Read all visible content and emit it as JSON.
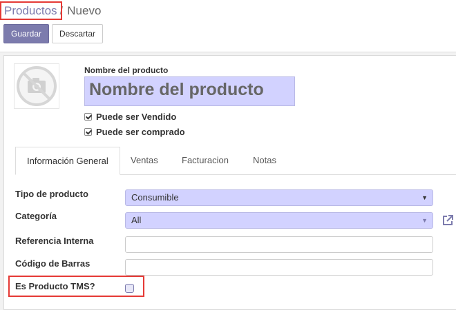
{
  "breadcrumb": {
    "parent": "Productos",
    "separator": "/",
    "current": "Nuevo"
  },
  "toolbar": {
    "save_label": "Guardar",
    "discard_label": "Descartar"
  },
  "product": {
    "name_label": "Nombre del producto",
    "name_placeholder": "Nombre del producto",
    "image_icon": "camera-placeholder-icon",
    "can_be_sold": {
      "label": "Puede ser Vendido",
      "checked": true
    },
    "can_be_purchased": {
      "label": "Puede ser comprado",
      "checked": true
    }
  },
  "tabs": [
    {
      "label": "Información General",
      "active": true
    },
    {
      "label": "Ventas",
      "active": false
    },
    {
      "label": "Facturacion",
      "active": false
    },
    {
      "label": "Notas",
      "active": false
    }
  ],
  "fields": {
    "product_type": {
      "label": "Tipo de producto",
      "value": "Consumible"
    },
    "category": {
      "label": "Categoría",
      "value": "All"
    },
    "internal_ref": {
      "label": "Referencia Interna",
      "value": ""
    },
    "barcode": {
      "label": "Código de Barras",
      "value": ""
    },
    "tms": {
      "label": "Es Producto TMS?",
      "checked": false
    }
  },
  "colors": {
    "accent": "#7c7bad",
    "required_bg": "#d2d2ff",
    "highlight": "#e53935"
  }
}
